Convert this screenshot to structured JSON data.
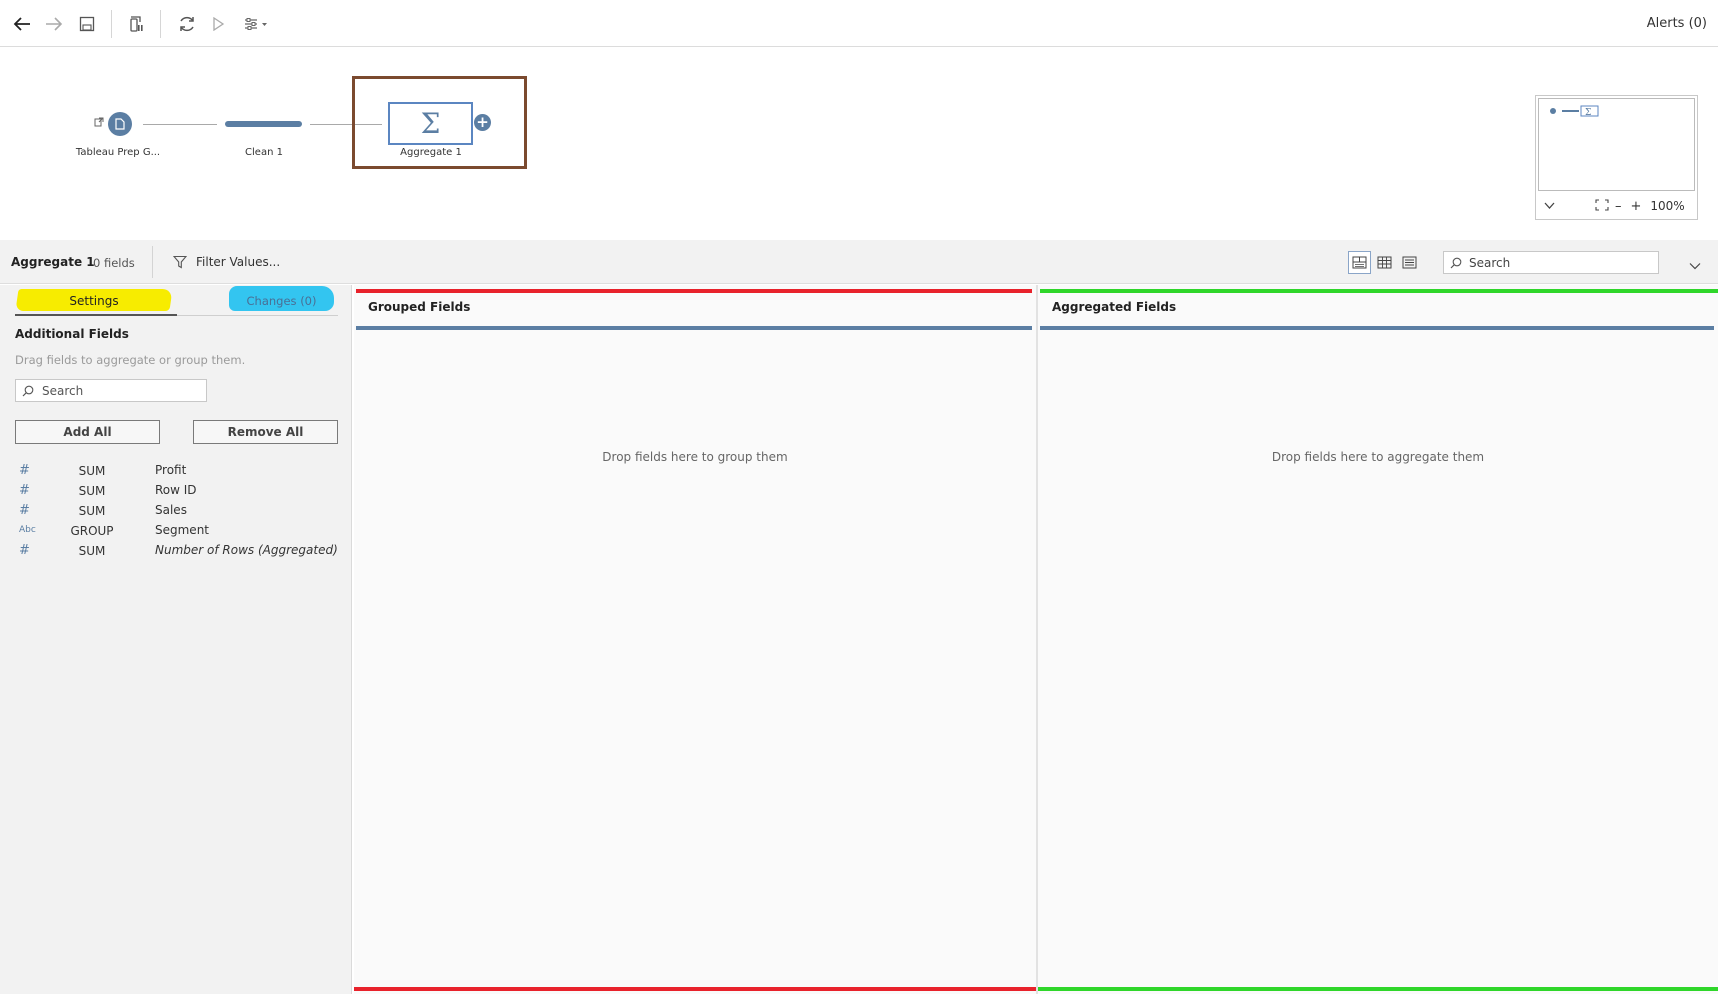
{
  "toolbar": {
    "alerts_label": "Alerts (0)"
  },
  "flow": {
    "steps": [
      {
        "label": "Tableau Prep G...",
        "kind": "input"
      },
      {
        "label": "Clean 1",
        "kind": "clean"
      },
      {
        "label": "Aggregate 1",
        "kind": "aggregate"
      }
    ],
    "minimap_zoom": "100%"
  },
  "step_bar": {
    "title": "Aggregate 1",
    "fields_count": "0 fields",
    "filter_label": "Filter Values...",
    "search_placeholder": "Search"
  },
  "settings_panel": {
    "tabs": [
      {
        "label": "Settings",
        "selected": true
      },
      {
        "label": "Changes (0)",
        "selected": false
      }
    ],
    "section_title": "Additional Fields",
    "hint": "Drag fields to aggregate or group them.",
    "search_placeholder": "Search",
    "add_all_label": "Add All",
    "remove_all_label": "Remove All",
    "fields": [
      {
        "type": "#",
        "agg": "SUM",
        "name": "Profit"
      },
      {
        "type": "#",
        "agg": "SUM",
        "name": "Row ID"
      },
      {
        "type": "#",
        "agg": "SUM",
        "name": "Sales"
      },
      {
        "type": "Abc",
        "agg": "GROUP",
        "name": "Segment"
      },
      {
        "type": "#",
        "agg": "SUM",
        "name": "Number of Rows (Aggregated)"
      }
    ]
  },
  "grouped": {
    "title": "Grouped Fields",
    "hint": "Drop fields here to group them"
  },
  "aggregated": {
    "title": "Aggregated Fields",
    "hint": "Drop fields here to aggregate them"
  },
  "colors": {
    "accent": "#5b7ea3",
    "grouped_outline": "#e8222b",
    "aggregated_outline": "#2fd62a",
    "flow_highlight": "#7b4a2f",
    "settings_highlight": "#f7ec00",
    "changes_highlight": "#33c5f0"
  }
}
